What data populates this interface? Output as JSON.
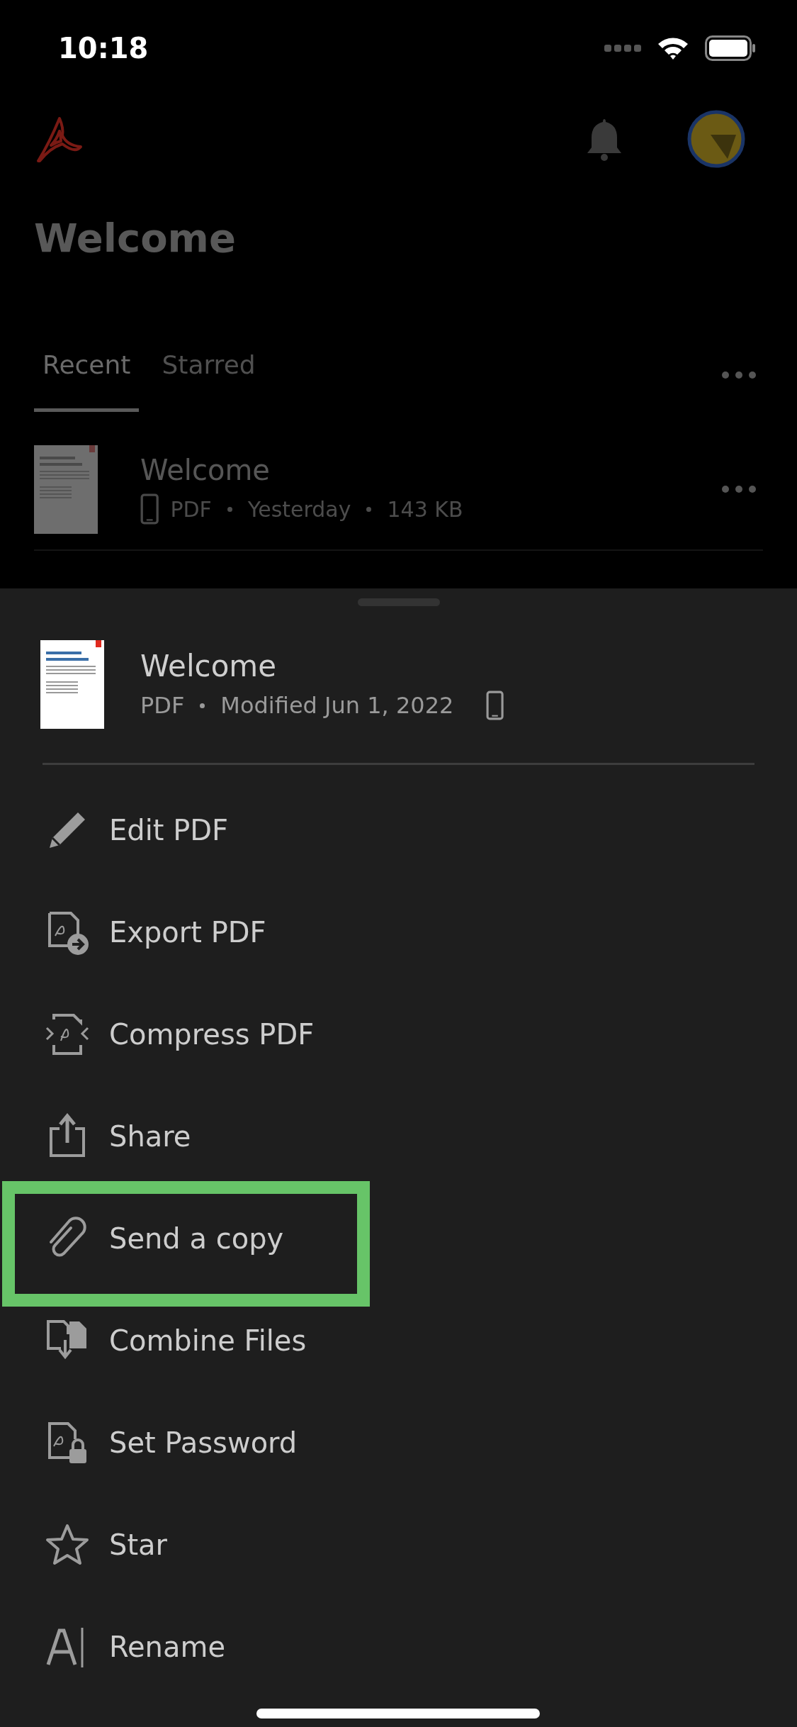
{
  "status_bar": {
    "time": "10:18"
  },
  "header": {
    "title": "Welcome"
  },
  "tabs": [
    {
      "label": "Recent",
      "selected": true
    },
    {
      "label": "Starred",
      "selected": false
    }
  ],
  "recent_files": [
    {
      "name": "Welcome",
      "type": "PDF",
      "date": "Yesterday",
      "size": "143 KB"
    }
  ],
  "sheet": {
    "file": {
      "name": "Welcome",
      "type": "PDF",
      "modified": "Modified Jun 1, 2022"
    },
    "menu": [
      {
        "kind": "edit",
        "label": "Edit PDF",
        "highlighted": false
      },
      {
        "kind": "export",
        "label": "Export PDF",
        "highlighted": false
      },
      {
        "kind": "compress",
        "label": "Compress PDF",
        "highlighted": false
      },
      {
        "kind": "share",
        "label": "Share",
        "highlighted": false
      },
      {
        "kind": "attach",
        "label": "Send a copy",
        "highlighted": true
      },
      {
        "kind": "combine",
        "label": "Combine Files",
        "highlighted": false
      },
      {
        "kind": "password",
        "label": "Set Password",
        "highlighted": false
      },
      {
        "kind": "star",
        "label": "Star",
        "highlighted": false
      },
      {
        "kind": "rename",
        "label": "Rename",
        "highlighted": false
      }
    ]
  }
}
